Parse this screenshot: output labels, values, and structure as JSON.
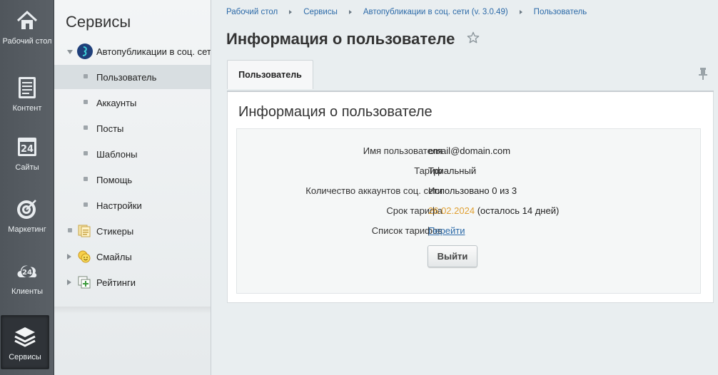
{
  "leftnav": {
    "items": [
      {
        "label": "Рабочий стол",
        "icon": "house-icon"
      },
      {
        "label": "Контент",
        "icon": "document-icon"
      },
      {
        "label": "Сайты",
        "icon": "calendar-24-icon"
      },
      {
        "label": "Маркетинг",
        "icon": "target-icon"
      },
      {
        "label": "Клиенты",
        "icon": "cloud-24-icon"
      },
      {
        "label": "Сервисы",
        "icon": "layers-icon"
      }
    ]
  },
  "menu": {
    "title": "Сервисы",
    "items": [
      {
        "label": "Автопубликации в соц. сети"
      },
      {
        "label": "Пользователь"
      },
      {
        "label": "Аккаунты"
      },
      {
        "label": "Посты"
      },
      {
        "label": "Шаблоны"
      },
      {
        "label": "Помощь"
      },
      {
        "label": "Настройки"
      },
      {
        "label": "Стикеры"
      },
      {
        "label": "Смайлы"
      },
      {
        "label": "Рейтинги"
      }
    ]
  },
  "breadcrumb": [
    "Рабочий стол",
    "Сервисы",
    "Автопубликации в соц. сети (v. 3.0.49)",
    "Пользователь"
  ],
  "page": {
    "title": "Информация о пользователе"
  },
  "tabs": {
    "user": "Пользователь"
  },
  "card": {
    "title": "Информация о пользователе",
    "rows": [
      {
        "label": "Имя пользователя",
        "value": "email@domain.com"
      },
      {
        "label": "Тариф",
        "value": "Триальный"
      },
      {
        "label": "Количество аккаунтов соц. сети",
        "value": "Использовано 0 из 3"
      },
      {
        "label": "Срок тарифа",
        "date": "26.02.2024",
        "remaining": " (осталось 14 дней)"
      },
      {
        "label": "Список тарифов",
        "link": "Перейти"
      }
    ],
    "logout_label": "Выйти"
  },
  "colors": {
    "accent_link": "#2c6aa8",
    "date_highlight": "#e0a033",
    "nav_bg": "#555b61"
  }
}
